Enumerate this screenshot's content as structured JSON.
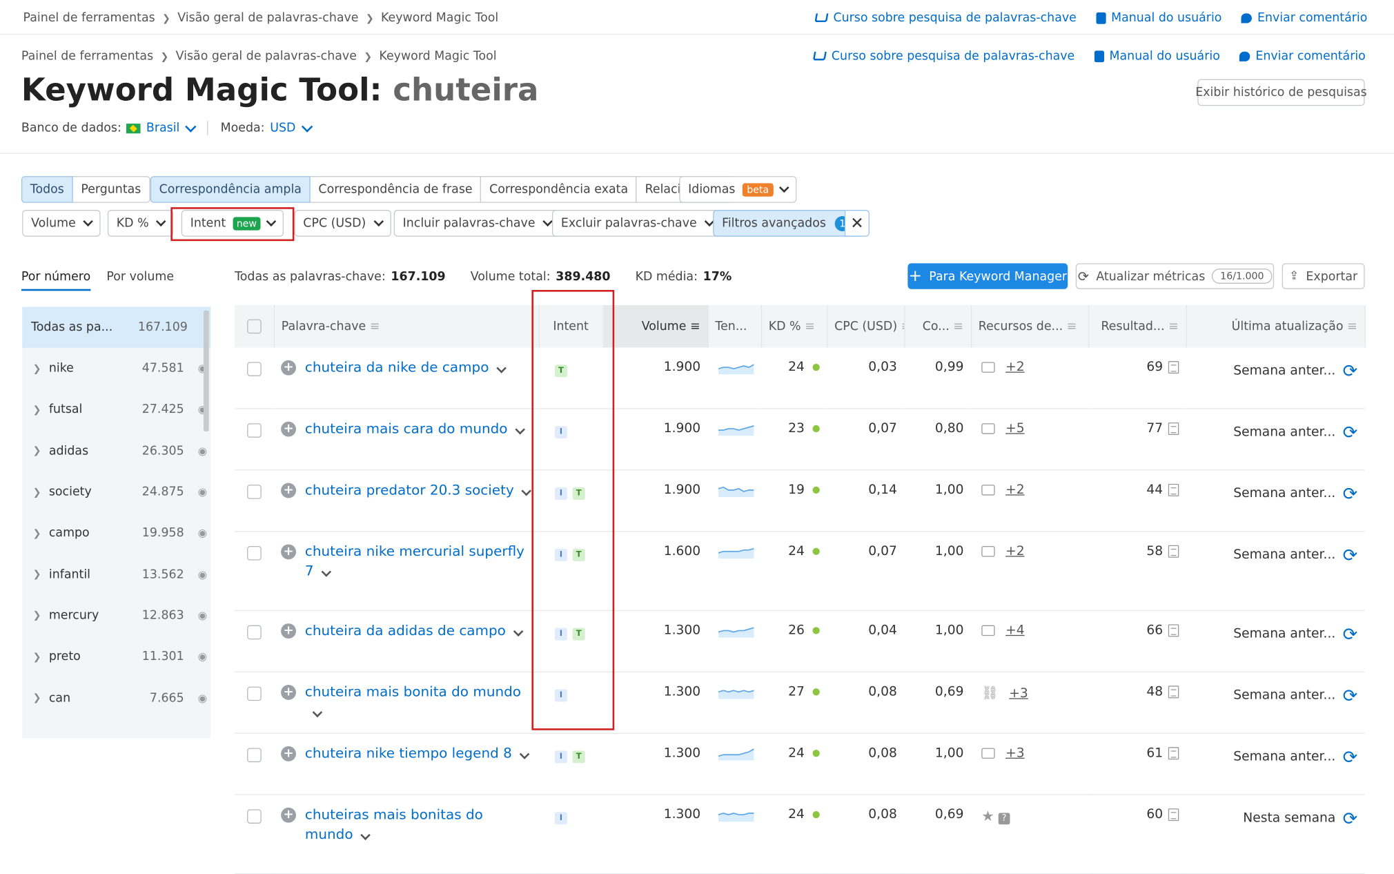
{
  "breadcrumb": [
    "Painel de ferramentas",
    "Visão geral de palavras-chave",
    "Keyword Magic Tool"
  ],
  "top_links": {
    "course": "Curso sobre pesquisa de palavras-chave",
    "manual": "Manual do usuário",
    "feedback": "Enviar comentário"
  },
  "title": {
    "tool": "Keyword Magic Tool:",
    "query": "chuteira"
  },
  "history_button": "Exibir histórico de pesquisas",
  "database": {
    "label": "Banco de dados:",
    "value": "Brasil"
  },
  "currency": {
    "label": "Moeda:",
    "value": "USD"
  },
  "match_tabs": {
    "group1": [
      "Todos",
      "Perguntas"
    ],
    "group2": [
      "Correspondência ampla",
      "Correspondência de frase",
      "Correspondência exata",
      "Relacionadas"
    ],
    "languages": "Idiomas",
    "beta": "beta"
  },
  "filters": {
    "volume": "Volume",
    "kd": "KD %",
    "intent": "Intent",
    "new_badge": "new",
    "cpc": "CPC (USD)",
    "include": "Incluir palavras-chave",
    "exclude": "Excluir palavras-chave",
    "advanced": "Filtros avançados",
    "advanced_count": "1"
  },
  "sidebar": {
    "tab_number": "Por número",
    "tab_volume": "Por volume",
    "all_label": "Todas as pa...",
    "all_count": "167.109",
    "items": [
      {
        "name": "nike",
        "count": "47.581"
      },
      {
        "name": "futsal",
        "count": "27.425"
      },
      {
        "name": "adidas",
        "count": "26.305"
      },
      {
        "name": "society",
        "count": "24.875"
      },
      {
        "name": "campo",
        "count": "19.958"
      },
      {
        "name": "infantil",
        "count": "13.562"
      },
      {
        "name": "mercury",
        "count": "12.863"
      },
      {
        "name": "preto",
        "count": "11.301"
      },
      {
        "name": "can",
        "count": "7.665"
      }
    ]
  },
  "summary": {
    "all_keywords_label": "Todas as palavras-chave:",
    "all_keywords": "167.109",
    "total_volume_label": "Volume total:",
    "total_volume": "389.480",
    "avg_kd_label": "KD média:",
    "avg_kd": "17%"
  },
  "actions": {
    "to_manager": "Para Keyword Manager",
    "update_metrics": "Atualizar métricas",
    "quota": "16/1.000",
    "export": "Exportar"
  },
  "columns": [
    "Palavra-chave",
    "Intent",
    "Volume",
    "Ten...",
    "KD %",
    "CPC (USD)",
    "Co...",
    "Recursos de...",
    "Resultad...",
    "Última atualização"
  ],
  "accent": "#006dca",
  "rows": [
    {
      "keyword": "chuteira da nike de campo",
      "intent": [
        "T"
      ],
      "volume": "1.900",
      "kd": "24",
      "cpc": "0,03",
      "com": "0,99",
      "serp_icon": "image-icon",
      "serp_extra": "+2",
      "results": "69",
      "updated": "Semana anter...",
      "trend": [
        4,
        5,
        5,
        4,
        5,
        6,
        5,
        7
      ]
    },
    {
      "keyword": "chuteira mais cara do mundo",
      "intent": [
        "I"
      ],
      "volume": "1.900",
      "kd": "23",
      "cpc": "0,07",
      "com": "0,80",
      "serp_icon": "image-icon",
      "serp_extra": "+5",
      "results": "77",
      "updated": "Semana anter...",
      "trend": [
        4,
        4,
        5,
        5,
        4,
        5,
        6,
        7
      ]
    },
    {
      "keyword": "chuteira predator 20.3 society",
      "intent": [
        "I",
        "T"
      ],
      "volume": "1.900",
      "kd": "19",
      "cpc": "0,14",
      "com": "1,00",
      "serp_icon": "image-icon",
      "serp_extra": "+2",
      "results": "44",
      "updated": "Semana anter...",
      "trend": [
        6,
        7,
        5,
        5,
        6,
        4,
        5,
        5
      ]
    },
    {
      "keyword": "chuteira nike mercurial superfly 7",
      "intent": [
        "I",
        "T"
      ],
      "volume": "1.600",
      "kd": "24",
      "cpc": "0,07",
      "com": "1,00",
      "serp_icon": "image-icon",
      "serp_extra": "+2",
      "results": "58",
      "updated": "Semana anter...",
      "trend": [
        4,
        5,
        5,
        5,
        5,
        6,
        6,
        7
      ]
    },
    {
      "keyword": "chuteira da adidas de campo",
      "intent": [
        "I",
        "T"
      ],
      "volume": "1.300",
      "kd": "26",
      "cpc": "0,04",
      "com": "1,00",
      "serp_icon": "image-icon",
      "serp_extra": "+4",
      "results": "66",
      "updated": "Semana anter...",
      "trend": [
        4,
        5,
        5,
        4,
        5,
        5,
        6,
        7
      ]
    },
    {
      "keyword": "chuteira mais bonita do mundo",
      "intent": [
        "I"
      ],
      "volume": "1.300",
      "kd": "27",
      "cpc": "0,08",
      "com": "0,69",
      "serp_icon": "link-icon",
      "serp_extra": "+3",
      "results": "48",
      "updated": "Semana anter...",
      "trend": [
        5,
        6,
        5,
        6,
        5,
        6,
        5,
        6
      ]
    },
    {
      "keyword": "chuteira nike tiempo legend 8",
      "intent": [
        "I",
        "T"
      ],
      "volume": "1.300",
      "kd": "24",
      "cpc": "0,08",
      "com": "1,00",
      "serp_icon": "image-icon",
      "serp_extra": "+3",
      "results": "61",
      "updated": "Semana anter...",
      "trend": [
        3,
        4,
        4,
        4,
        4,
        5,
        6,
        8
      ]
    },
    {
      "keyword": "chuteiras mais bonitas do mundo",
      "intent": [
        "I"
      ],
      "volume": "1.300",
      "kd": "24",
      "cpc": "0,08",
      "com": "0,69",
      "serp_icon": "star-icon",
      "serp_extra": "",
      "results": "60",
      "updated": "Nesta semana",
      "trend": [
        5,
        6,
        5,
        6,
        5,
        5,
        6,
        6
      ]
    }
  ]
}
